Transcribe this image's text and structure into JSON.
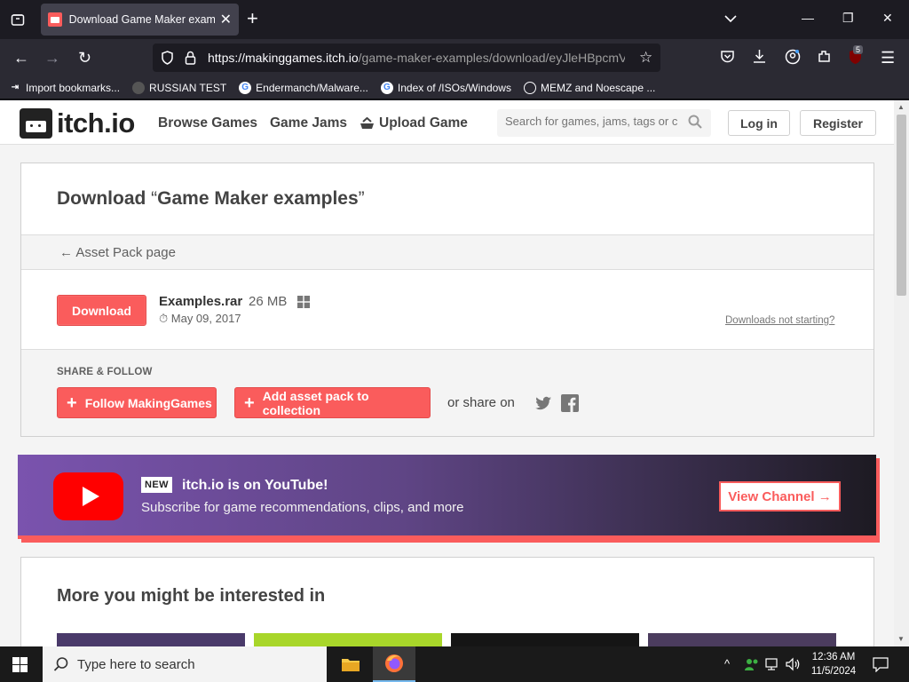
{
  "browser": {
    "tab_title": "Download Game Maker examples",
    "url_host": "https://makinggames.itch.io",
    "url_path": "/game-maker-examples/download/eyJleHBpcmVz",
    "extensions_badge": "5",
    "bookmarks": [
      {
        "label": "Import bookmarks...",
        "icon": "import-icon"
      },
      {
        "label": "RUSSIAN TEST",
        "icon": "globe-icon"
      },
      {
        "label": "Endermanch/Malware...",
        "icon": "google-icon"
      },
      {
        "label": "Index of /ISOs/Windows",
        "icon": "google-icon"
      },
      {
        "label": "MEMZ and Noescape ...",
        "icon": "globe-icon"
      }
    ]
  },
  "header": {
    "logo_text": "itch.io",
    "nav": [
      "Browse Games",
      "Game Jams",
      "Upload Game"
    ],
    "search_placeholder": "Search for games, jams, tags or c",
    "login": "Log in",
    "register": "Register"
  },
  "download": {
    "title_prefix": "Download",
    "title_open_quote": "“",
    "title_name": "Game Maker examples",
    "title_close_quote": "”",
    "back_link": "← Asset Pack page",
    "button": "Download",
    "file_name": "Examples.rar",
    "file_size": "26 MB",
    "file_date": "May 09, 2017",
    "help_link": "Downloads not starting?"
  },
  "share": {
    "title": "SHARE & FOLLOW",
    "follow_button": "Follow MakingGames",
    "collection_button": "Add asset pack to collection",
    "or_share": "or share on"
  },
  "youtube_banner": {
    "new_tag": "NEW",
    "title": "itch.io is on YouTube!",
    "subtitle": "Subscribe for game recommendations, clips, and more",
    "button": "View Channel →"
  },
  "more": {
    "title": "More you might be interested in"
  },
  "taskbar": {
    "search_placeholder": "Type here to search",
    "time": "12:36 AM",
    "date": "11/5/2024"
  },
  "colors": {
    "accent": "#fa5c5c",
    "page_bg": "#f4f4f4",
    "browser_bg": "#1c1b22"
  }
}
